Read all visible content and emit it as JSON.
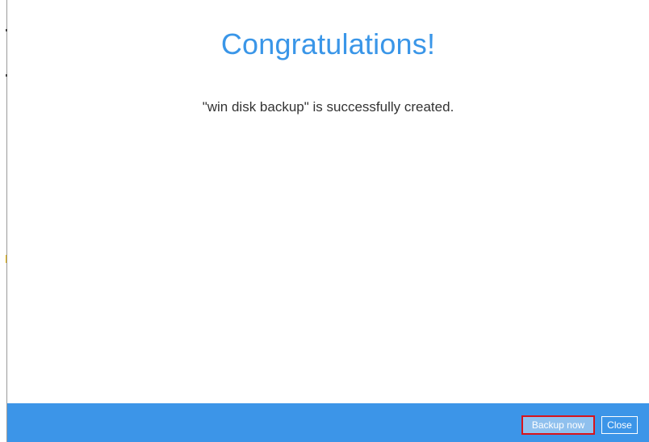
{
  "dialog": {
    "title": "Congratulations!",
    "message": "\"win disk backup\" is successfully created."
  },
  "footer": {
    "backup_now_label": "Backup now",
    "close_label": "Close"
  },
  "colors": {
    "accent": "#3a96e8",
    "footer_bar": "#3c95e8",
    "highlight_border": "#d8131b"
  }
}
